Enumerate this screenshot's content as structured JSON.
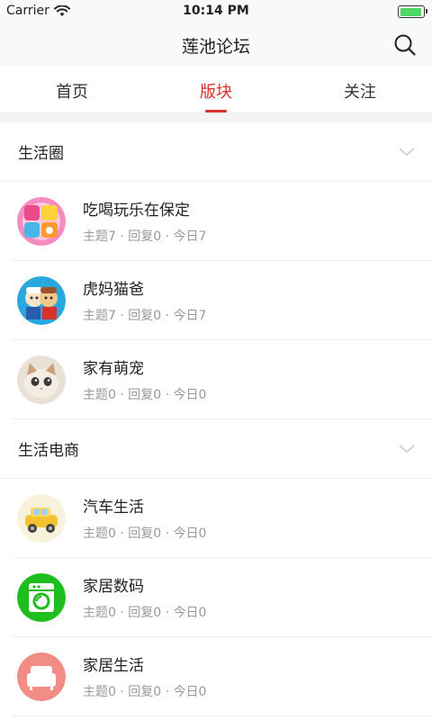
{
  "status": {
    "carrier": "Carrier",
    "time": "10:14 PM",
    "battery_level": 0.95
  },
  "nav": {
    "title": "莲池论坛",
    "search_icon": "search-icon"
  },
  "tabs": [
    {
      "label": "首页",
      "active": false
    },
    {
      "label": "版块",
      "active": true
    },
    {
      "label": "关注",
      "active": false
    }
  ],
  "accent_color": "#d9302c",
  "sections": [
    {
      "title": "生活圈",
      "items": [
        {
          "name": "吃喝玩乐在保定",
          "meta": "主题7 · 回复0 · 今日7",
          "icon": "food-fun-icon"
        },
        {
          "name": "虎妈猫爸",
          "meta": "主题7 · 回复0 · 今日7",
          "icon": "parents-icon"
        },
        {
          "name": "家有萌宠",
          "meta": "主题0 · 回复0 · 今日0",
          "icon": "pet-cat-icon"
        }
      ]
    },
    {
      "title": "生活电商",
      "items": [
        {
          "name": "汽车生活",
          "meta": "主题0 · 回复0 · 今日0",
          "icon": "car-icon"
        },
        {
          "name": "家居数码",
          "meta": "主题0 · 回复0 · 今日0",
          "icon": "washing-machine-icon"
        },
        {
          "name": "家居生活",
          "meta": "主题0 · 回复0 · 今日0",
          "icon": "sofa-icon"
        }
      ]
    }
  ]
}
